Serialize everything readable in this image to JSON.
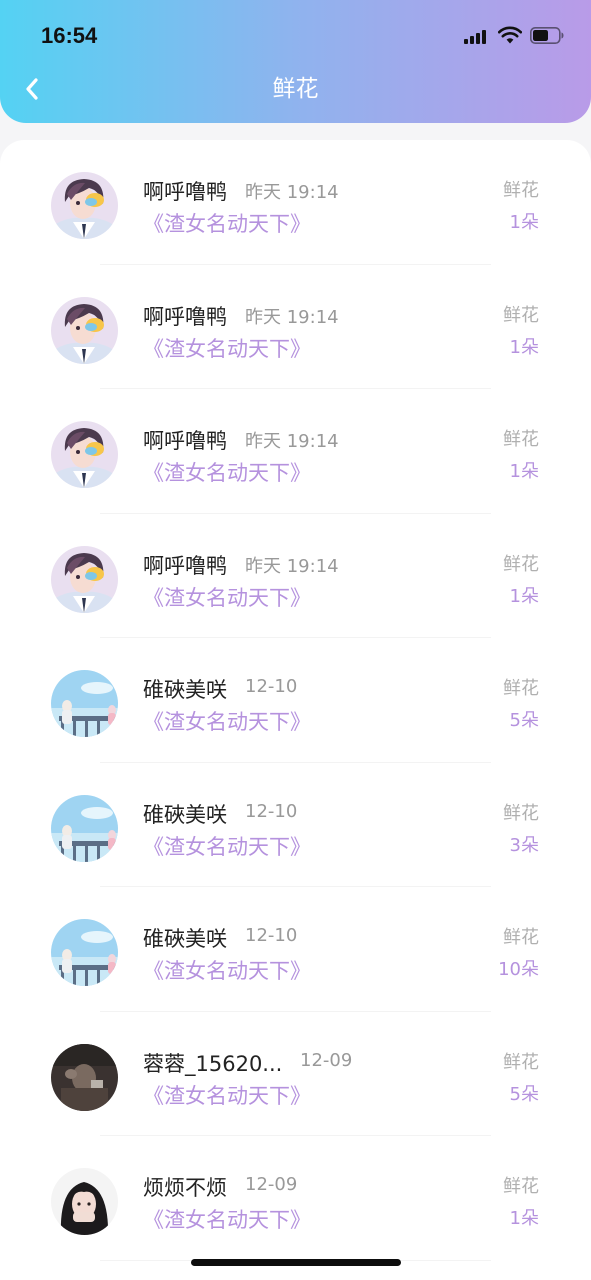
{
  "status_bar": {
    "time": "16:54"
  },
  "nav": {
    "title": "鲜花"
  },
  "records": [
    {
      "name": "啊呼噜鸭",
      "date": "昨天 19:14",
      "book": "《渣女名动天下》",
      "type": "鲜花",
      "count": "1朵",
      "avatar": "anime-boy"
    },
    {
      "name": "啊呼噜鸭",
      "date": "昨天 19:14",
      "book": "《渣女名动天下》",
      "type": "鲜花",
      "count": "1朵",
      "avatar": "anime-boy"
    },
    {
      "name": "啊呼噜鸭",
      "date": "昨天 19:14",
      "book": "《渣女名动天下》",
      "type": "鲜花",
      "count": "1朵",
      "avatar": "anime-boy"
    },
    {
      "name": "啊呼噜鸭",
      "date": "昨天 19:14",
      "book": "《渣女名动天下》",
      "type": "鲜花",
      "count": "1朵",
      "avatar": "anime-boy"
    },
    {
      "name": "碓硤美咲",
      "date": "12-10",
      "book": "《渣女名动天下》",
      "type": "鲜花",
      "count": "5朵",
      "avatar": "sky-scene"
    },
    {
      "name": "碓硤美咲",
      "date": "12-10",
      "book": "《渣女名动天下》",
      "type": "鲜花",
      "count": "3朵",
      "avatar": "sky-scene"
    },
    {
      "name": "碓硤美咲",
      "date": "12-10",
      "book": "《渣女名动天下》",
      "type": "鲜花",
      "count": "10朵",
      "avatar": "sky-scene"
    },
    {
      "name": "蓉蓉_15620...",
      "date": "12-09",
      "book": "《渣女名动天下》",
      "type": "鲜花",
      "count": "5朵",
      "avatar": "dark-photo"
    },
    {
      "name": "烦烦不烦",
      "date": "12-09",
      "book": "《渣女名动天下》",
      "type": "鲜花",
      "count": "1朵",
      "avatar": "girl-photo"
    }
  ]
}
